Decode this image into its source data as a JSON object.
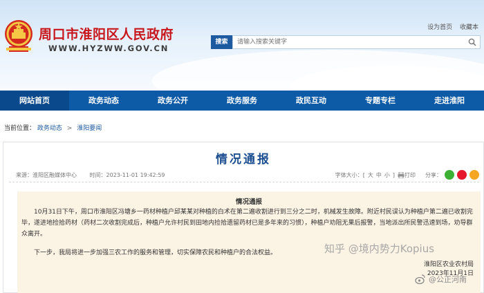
{
  "header": {
    "site_title": "周口市淮阳区人民政府",
    "site_url": "WWW.HYZWW.GOV.CN",
    "top_links": [
      "设为首页",
      "收藏本"
    ],
    "search": {
      "button_label": "搜索",
      "placeholder": "请输入搜索关键字"
    }
  },
  "nav": {
    "items": [
      "网站首页",
      "政务动态",
      "政务公开",
      "政务服务",
      "政民互动",
      "专题专栏",
      "走进淮阳"
    ],
    "active_index": 0
  },
  "breadcrumb": {
    "label": "当前位置：",
    "items": [
      "政务动态",
      "淮阳要闻"
    ]
  },
  "article": {
    "title": "情况通报",
    "source": "来源：淮阳区融媒体中心",
    "time": "时间：2023-11-01 19:42:59",
    "font_size_label": "字体大小：",
    "font_sizes": [
      "大",
      "中",
      "小"
    ],
    "print_label": "打印",
    "share_label": "分享：",
    "content_title": "情况通报",
    "paragraph1": "10月31日下午，周口市淮阳区冯塘乡一药材种植户邱某某对种植的白术在第二遍收割进行到三分之二时，机械发生故障。附近村民误认为种植户第二遍已收割完毕，遂进地捡拾药材（药材二次收割完成后，种植户允许村民到田地内捡拾遗留药材已是多年来的习惯），种植户劝阻无果后报警，当地派出所民警迅速到场，劝导群众离开。",
    "paragraph2": "下一步，我局将进一步加强三农工作的服务和管理，切实保障农民和种植户的合法权益。",
    "signature": "淮阳区农业农村局",
    "signature_date": "2023年11月1日"
  },
  "watermarks": {
    "zhihu": "知乎 @境内势力Kopius",
    "weibo": "@公正河南"
  },
  "colors": {
    "nav_bg": "#0d5aa6",
    "title_red": "#c8161d",
    "article_title": "#1d4f91",
    "content_bg": "#fbf3e4"
  }
}
